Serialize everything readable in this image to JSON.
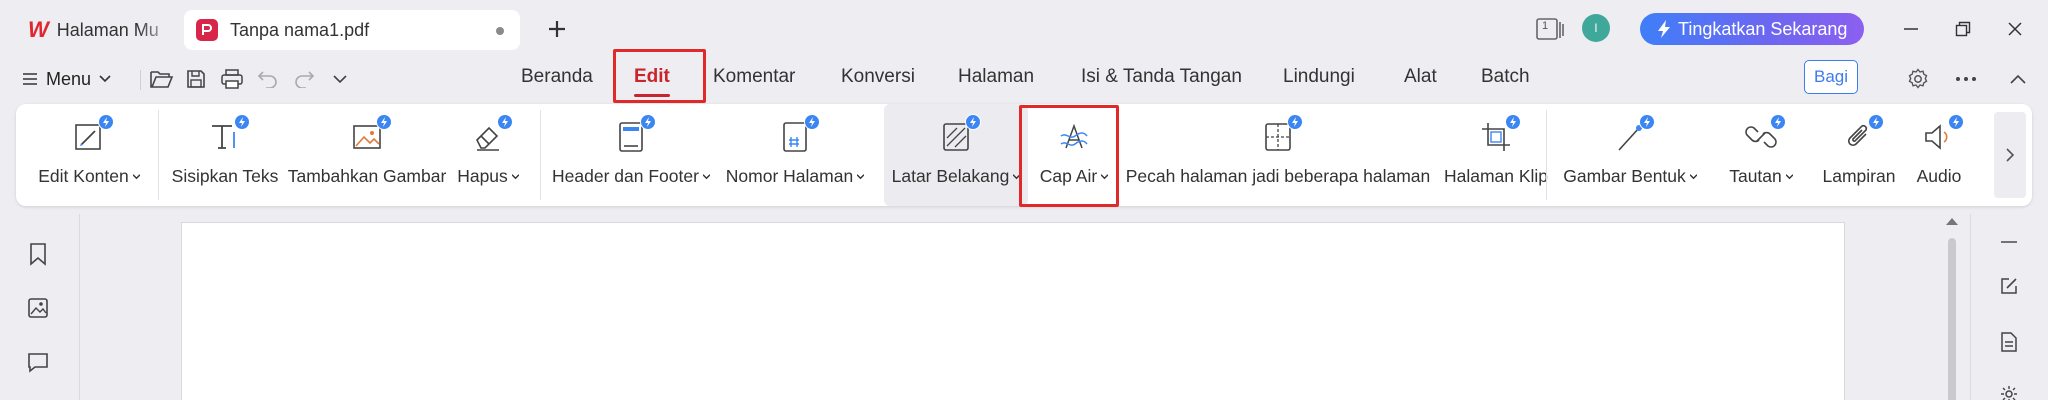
{
  "tabs": [
    {
      "label": "Halaman Mu",
      "icon": "wps-logo-icon"
    },
    {
      "label": "Tanpa nama1.pdf",
      "icon": "pdf-file-icon"
    }
  ],
  "titlebar": {
    "page_count": "1",
    "avatar_initial": "l",
    "upgrade_label": "Tingkatkan Sekarang"
  },
  "menu": {
    "menu_label": "Menu",
    "nav_tabs": [
      "Beranda",
      "Edit",
      "Komentar",
      "Konversi",
      "Halaman",
      "Isi & Tanda Tangan",
      "Lindungi",
      "Alat",
      "Batch"
    ],
    "active_tab": "Edit",
    "share_label": "Bagi"
  },
  "ribbon": {
    "tools": [
      {
        "label": "Edit Konten",
        "dropdown": true,
        "icon": "edit-content-icon"
      },
      {
        "label": "Sisipkan Teks",
        "dropdown": false,
        "icon": "insert-text-icon"
      },
      {
        "label": "Tambahkan Gambar",
        "dropdown": false,
        "icon": "add-image-icon"
      },
      {
        "label": "Hapus",
        "dropdown": true,
        "icon": "eraser-icon"
      },
      {
        "label": "Header dan Footer",
        "dropdown": true,
        "icon": "header-footer-icon"
      },
      {
        "label": "Nomor Halaman",
        "dropdown": true,
        "icon": "page-number-icon"
      },
      {
        "label": "Latar Belakang",
        "dropdown": true,
        "icon": "background-icon"
      },
      {
        "label": "Cap Air",
        "dropdown": true,
        "icon": "watermark-icon"
      },
      {
        "label": "Pecah halaman jadi beberapa halaman",
        "dropdown": false,
        "icon": "split-page-icon"
      },
      {
        "label": "Halaman Klip",
        "dropdown": false,
        "icon": "crop-page-icon"
      },
      {
        "label": "Gambar Bentuk",
        "dropdown": true,
        "icon": "draw-shape-icon"
      },
      {
        "label": "Tautan",
        "dropdown": true,
        "icon": "link-icon"
      },
      {
        "label": "Lampiran",
        "dropdown": false,
        "icon": "attachment-icon"
      },
      {
        "label": "Audio",
        "dropdown": false,
        "icon": "audio-icon"
      }
    ]
  },
  "colors": {
    "accent_red": "#c8262c",
    "highlight_box": "#e02a2a",
    "badge_blue": "#3c86f4",
    "upgrade_gradient_start": "#3f7ef8",
    "upgrade_gradient_end": "#8c5ff0"
  }
}
